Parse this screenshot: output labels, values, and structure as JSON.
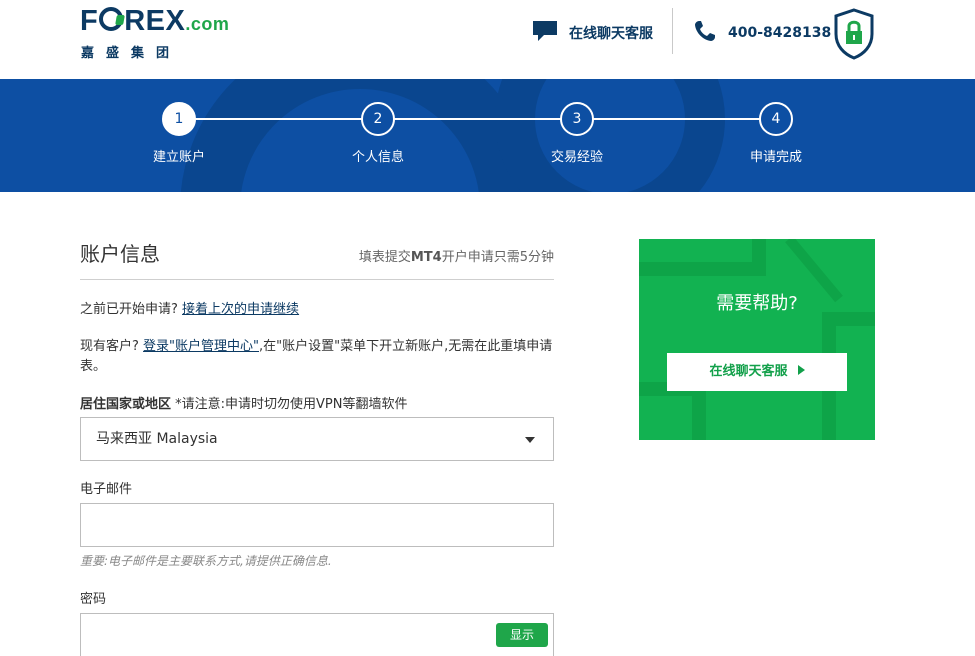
{
  "brand": {
    "logo_text_pre": "F",
    "logo_text_post": "REX",
    "logo_domain": ".com",
    "logo_sub": "嘉盛集团"
  },
  "header": {
    "chat_label": "在线聊天客服",
    "phone_label": "400-8428138",
    "chat_icon": "chat-bubble-icon",
    "phone_icon": "phone-icon",
    "lock_icon": "lock-shield-icon"
  },
  "steps": [
    {
      "number": "1",
      "label": "建立账户",
      "active": true
    },
    {
      "number": "2",
      "label": "个人信息",
      "active": false
    },
    {
      "number": "3",
      "label": "交易经验",
      "active": false
    },
    {
      "number": "4",
      "label": "申请完成",
      "active": false
    }
  ],
  "form": {
    "title": "账户信息",
    "hint_pre": "填表提交",
    "hint_bold": "MT4",
    "hint_post": "开户申请只需5分钟",
    "resume_question": "之前已开始申请?",
    "resume_link": "接着上次的申请继续",
    "existing_pre": "现有客户?",
    "existing_link": "登录\"账户管理中心\"",
    "existing_post": ",在\"账户设置\"菜单下开立新账户,无需在此重填申请表。",
    "country_label": "居住国家或地区",
    "country_note": "*请注意:申请时切勿使用VPN等翻墙软件",
    "country_value": "马来西亚 Malaysia",
    "email_label": "电子邮件",
    "email_value": "",
    "email_note": "重要:电子邮件是主要联系方式,请提供正确信息.",
    "password_label": "密码",
    "password_value": "",
    "show_label": "显示"
  },
  "help": {
    "title": "需要帮助?",
    "button_label": "在线聊天客服"
  },
  "colors": {
    "brand_navy": "#0c3a63",
    "band_blue": "#0d4fa3",
    "help_green": "#12b251",
    "button_green": "#1fa64a"
  }
}
